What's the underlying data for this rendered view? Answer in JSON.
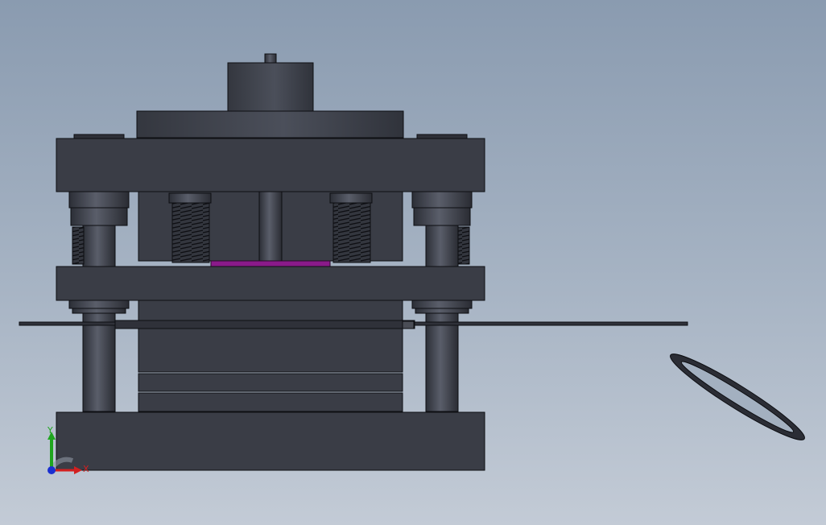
{
  "viewport": {
    "background_top": "#8a9bb0",
    "background_bottom": "#c3cbd6"
  },
  "model": {
    "body_color": "#3a3d46",
    "edge_color": "#0d0e12",
    "accent_color": "#8a1a8a",
    "parts": [
      "punch-holder-hub",
      "upper-die-plate",
      "stripper-plate",
      "guide-pillars",
      "die-springs",
      "strip-material",
      "die-block",
      "lower-die-plate",
      "blanked-ring-part"
    ]
  },
  "triad": {
    "y_label": "Y",
    "x_label": "X",
    "y_color": "#1fa61f",
    "x_color": "#d22020",
    "z_color": "#1a2fd0"
  }
}
